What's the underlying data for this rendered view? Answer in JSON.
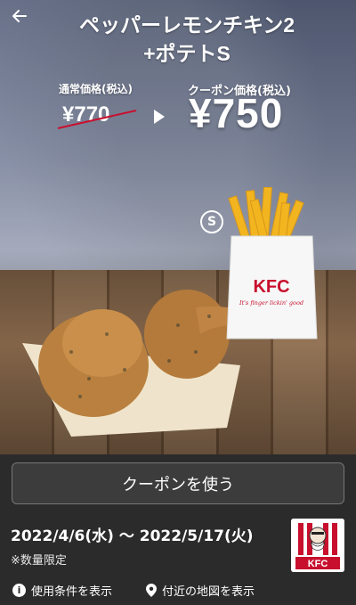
{
  "header": {
    "back_icon": "arrow-left-icon",
    "title_line1": "ペッパーレモンチキン2",
    "title_line2": "+ポテトS"
  },
  "pricing": {
    "regular_label": "通常価格(税込)",
    "regular_price": "¥770",
    "coupon_label": "クーポン価格(税込)",
    "coupon_price": "¥750"
  },
  "product": {
    "size_badge": "S",
    "pack_brand": "KFC",
    "pack_slogan": "It's finger lickin' good"
  },
  "action": {
    "use_coupon_label": "クーポンを使う"
  },
  "validity": {
    "date_range": "2022/4/6(水) ～ 2022/5/17(火)",
    "limit_note": "※数量限定"
  },
  "logo": {
    "brand": "KFC"
  },
  "links": {
    "terms_label": "使用条件を表示",
    "map_label": "付近の地図を表示"
  },
  "colors": {
    "kfc_red": "#c8102e",
    "background": "#2b2b2b"
  }
}
